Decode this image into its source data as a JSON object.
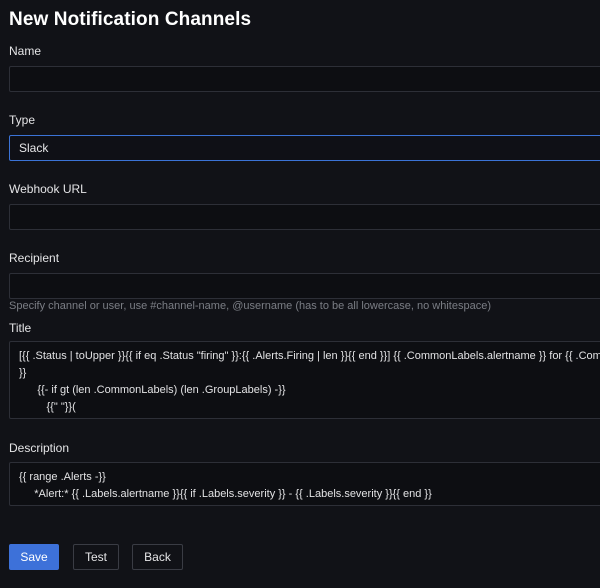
{
  "page": {
    "title": "New Notification Channels"
  },
  "form": {
    "name": {
      "label": "Name",
      "value": ""
    },
    "type": {
      "label": "Type",
      "selected": "Slack"
    },
    "webhook": {
      "label": "Webhook URL",
      "value": ""
    },
    "recipient": {
      "label": "Recipient",
      "value": "",
      "hint": "Specify channel or user, use #channel-name, @username (has to be all lowercase, no whitespace)"
    },
    "title_field": {
      "label": "Title",
      "lines": [
        "[{{ .Status | toUpper }}{{ if eq .Status \"firing\" }}:{{ .Alerts.Firing | len }}{{ end }}] {{ .CommonLabels.alertname }} for {{ .CommonLabels.job }}",
        "}}",
        "      {{- if gt (len .CommonLabels) (len .GroupLabels) -}}",
        "         {{\" \"}}("
      ]
    },
    "description": {
      "label": "Description",
      "lines": [
        "{{ range .Alerts -}}",
        "     *Alert:* {{ .Labels.alertname }}{{ if .Labels.severity }} - {{ .Labels.severity }}{{ end }}"
      ]
    }
  },
  "actions": {
    "save": "Save",
    "test": "Test",
    "back": "Back"
  },
  "colors": {
    "background": "#111217",
    "primary": "#3d71d9",
    "focus_border": "#3b73d6"
  }
}
